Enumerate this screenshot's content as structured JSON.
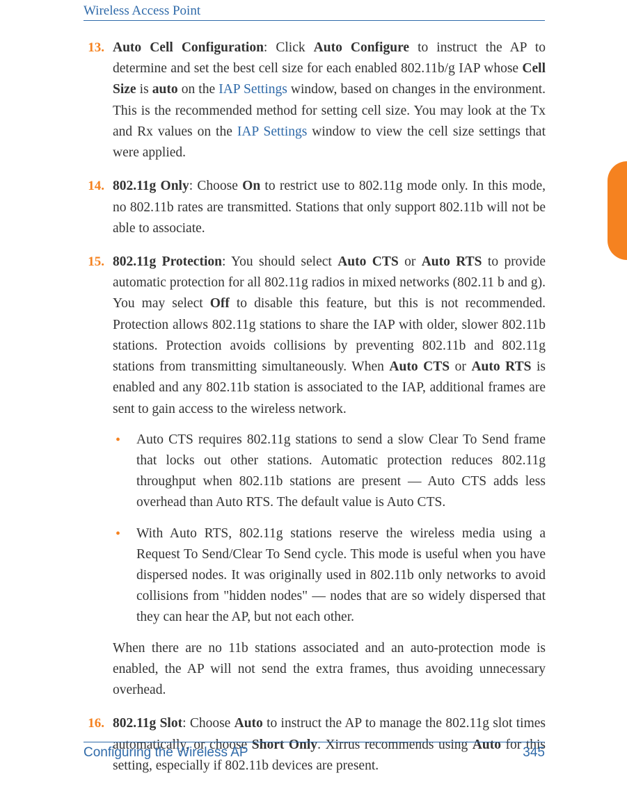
{
  "header": {
    "title": "Wireless Access Point"
  },
  "footer": {
    "section": "Configuring the Wireless AP",
    "page": "345"
  },
  "items": [
    {
      "num": "13.",
      "parts": [
        {
          "t": "Auto Cell Configuration",
          "b": true
        },
        {
          "t": ": Click "
        },
        {
          "t": "Auto Configure",
          "b": true
        },
        {
          "t": " to instruct the AP to determine and set the best cell size for each enabled 802.11b/g IAP whose "
        },
        {
          "t": "Cell Size",
          "b": true
        },
        {
          "t": " is "
        },
        {
          "t": "auto",
          "b": true
        },
        {
          "t": " on the "
        },
        {
          "t": "IAP Settings",
          "link": true
        },
        {
          "t": " window, based on changes in the environment. This is the recommended method for setting cell size. You may look at the Tx and Rx values on the "
        },
        {
          "t": "IAP Settings",
          "link": true
        },
        {
          "t": " window to view the cell size settings that were applied."
        }
      ]
    },
    {
      "num": "14.",
      "parts": [
        {
          "t": "802.11g Only",
          "b": true
        },
        {
          "t": ": Choose "
        },
        {
          "t": "On",
          "b": true
        },
        {
          "t": " to restrict use to 802.11g mode only. In this mode, no 802.11b rates are transmitted. Stations that only support 802.11b will not be able to associate."
        }
      ]
    },
    {
      "num": "15.",
      "parts": [
        {
          "t": "802.11g Protection",
          "b": true
        },
        {
          "t": ": You should select "
        },
        {
          "t": "Auto CTS",
          "b": true
        },
        {
          "t": " or "
        },
        {
          "t": "Auto RTS",
          "b": true
        },
        {
          "t": " to provide automatic protection for all 802.11g radios in mixed networks (802.11 b and g). You may select "
        },
        {
          "t": "Off",
          "b": true
        },
        {
          "t": " to disable this feature, but this is not recommended. Protection allows 802.11g stations to share the IAP with older, slower 802.11b stations. Protection avoids collisions by preventing 802.11b and 802.11g stations from transmitting simultaneously. When "
        },
        {
          "t": "Auto CTS",
          "b": true
        },
        {
          "t": " or "
        },
        {
          "t": "Auto RTS",
          "b": true
        },
        {
          "t": " is enabled and any 802.11b station is associated to the IAP, additional frames are sent to gain access to the wireless network."
        }
      ],
      "sub": [
        {
          "t": "Auto CTS requires 802.11g stations to send a slow Clear To Send frame that locks out other stations. Automatic protection reduces 802.11g throughput when 802.11b stations are present — Auto CTS adds less overhead than Auto RTS. The default value is Auto CTS."
        },
        {
          "t": "With Auto RTS, 802.11g stations reserve the wireless media using a Request To Send/Clear To Send cycle. This mode is useful when you have dispersed nodes. It was originally used in 802.11b only networks to avoid collisions from \"hidden nodes\" — nodes that are so widely dispersed that they can hear the AP, but not each other."
        }
      ],
      "tail": "When there are no 11b stations associated and an auto-protection mode is enabled, the AP will not send the extra frames, thus avoiding unnecessary overhead."
    },
    {
      "num": "16.",
      "parts": [
        {
          "t": "802.11g Slot",
          "b": true
        },
        {
          "t": ": Choose "
        },
        {
          "t": "Auto",
          "b": true
        },
        {
          "t": " to instruct the AP to manage the 802.11g slot times automatically, or choose "
        },
        {
          "t": "Short Only",
          "b": true
        },
        {
          "t": ". Xirrus recommends using "
        },
        {
          "t": "Auto",
          "b": true
        },
        {
          "t": " for this setting, especially if 802.11b devices are present."
        }
      ]
    }
  ]
}
